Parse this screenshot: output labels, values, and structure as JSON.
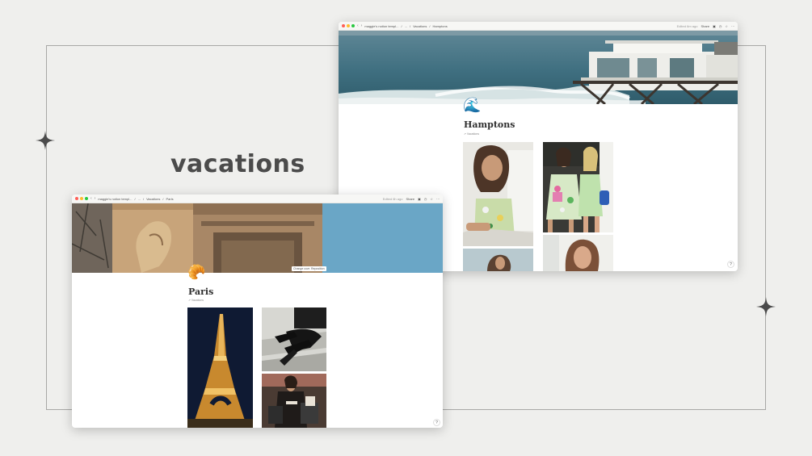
{
  "headline": "vacations",
  "colors": {
    "background": "#efefed",
    "frame": "#a8a8a6",
    "headline": "#4b4b4b",
    "traffic_red": "#ff5f57",
    "traffic_yellow": "#febc2e",
    "traffic_green": "#28c840"
  },
  "hamptons_window": {
    "breadcrumbs": [
      "maggie's notion templ...",
      "/",
      "...",
      "/",
      "Vacations",
      "/",
      "Hamptons"
    ],
    "edited": "Edited 6m ago",
    "share": "Share",
    "page_icon": "🌊",
    "page_icon_name": "water-wave-icon",
    "title": "Hamptons",
    "property": "Vacations",
    "help": "?"
  },
  "paris_window": {
    "breadcrumbs": [
      "maggie's notion templ...",
      "/",
      "...",
      "/",
      "Vacations",
      "/",
      "Paris"
    ],
    "edited": "Edited 6h ago",
    "share": "Share",
    "page_icon": "🥐",
    "page_icon_name": "croissant-icon",
    "title": "Paris",
    "property": "Vacations",
    "change_cover": "Change cover",
    "reposition": "Reposition",
    "help": "?"
  }
}
